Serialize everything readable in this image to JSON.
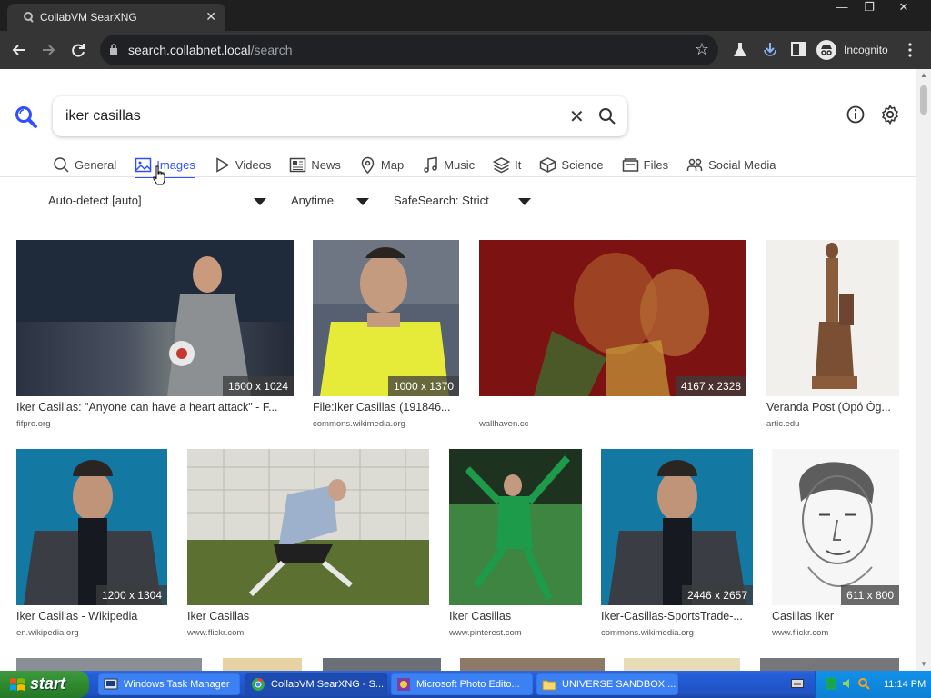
{
  "browser": {
    "tab_title": "CollabVM SearXNG",
    "tab_close": "✕",
    "url_host": "search.collabnet.local",
    "url_path": "/search",
    "incognito_label": "Incognito",
    "window_controls": [
      "—",
      "❐",
      "✕"
    ]
  },
  "search": {
    "query": "iker casillas",
    "clear_symbol": "✕"
  },
  "categories": [
    {
      "label": "General",
      "icon": "search-icon",
      "active": false
    },
    {
      "label": "Images",
      "icon": "image-icon",
      "active": true
    },
    {
      "label": "Videos",
      "icon": "play-icon",
      "active": false
    },
    {
      "label": "News",
      "icon": "newspaper-icon",
      "active": false
    },
    {
      "label": "Map",
      "icon": "map-pin-icon",
      "active": false
    },
    {
      "label": "Music",
      "icon": "music-icon",
      "active": false
    },
    {
      "label": "It",
      "icon": "layers-icon",
      "active": false
    },
    {
      "label": "Science",
      "icon": "science-icon",
      "active": false
    },
    {
      "label": "Files",
      "icon": "files-icon",
      "active": false
    },
    {
      "label": "Social Media",
      "icon": "people-icon",
      "active": false
    }
  ],
  "filters": {
    "language": "Auto-detect [auto]",
    "time": "Anytime",
    "safesearch": "SafeSearch: Strict"
  },
  "results": [
    {
      "title": "Iker Casillas: \"Anyone can have a heart attack\" - F...",
      "source": "fifpro.org",
      "resolution": "1600 x 1024"
    },
    {
      "title": "File:Iker Casillas (191846...",
      "source": "commons.wikimedia.org",
      "resolution": "1000 x 1370"
    },
    {
      "title": "",
      "source": "wallhaven.cc",
      "resolution": "4167 x 2328"
    },
    {
      "title": "Veranda Post (Òpó Òg...",
      "source": "artic.edu",
      "resolution": ""
    },
    {
      "title": "Iker Casillas - Wikipedia",
      "source": "en.wikipedia.org",
      "resolution": "1200 x 1304"
    },
    {
      "title": "Iker Casillas",
      "source": "www.flickr.com",
      "resolution": ""
    },
    {
      "title": "Iker Casillas",
      "source": "www.pinterest.com",
      "resolution": ""
    },
    {
      "title": "Iker-Casillas-SportsTrade-...",
      "source": "commons.wikimedia.org",
      "resolution": "2446 x 2657"
    },
    {
      "title": "Casillas Iker",
      "source": "www.flickr.com",
      "resolution": "611 x 800"
    }
  ],
  "taskbar": {
    "start_label": "start",
    "items": [
      {
        "label": "Windows Task Manager",
        "active": false
      },
      {
        "label": "CollabVM SearXNG - S...",
        "active": true
      },
      {
        "label": "Microsoft Photo Edito...",
        "active": false
      },
      {
        "label": "UNIVERSE SANDBOX ...",
        "active": false
      }
    ],
    "clock": "11:14 PM"
  },
  "colors": {
    "accent": "#3050ff",
    "chrome_dark": "#202124",
    "xp_taskbar": "#245edb",
    "xp_start": "#2f8a2f"
  }
}
